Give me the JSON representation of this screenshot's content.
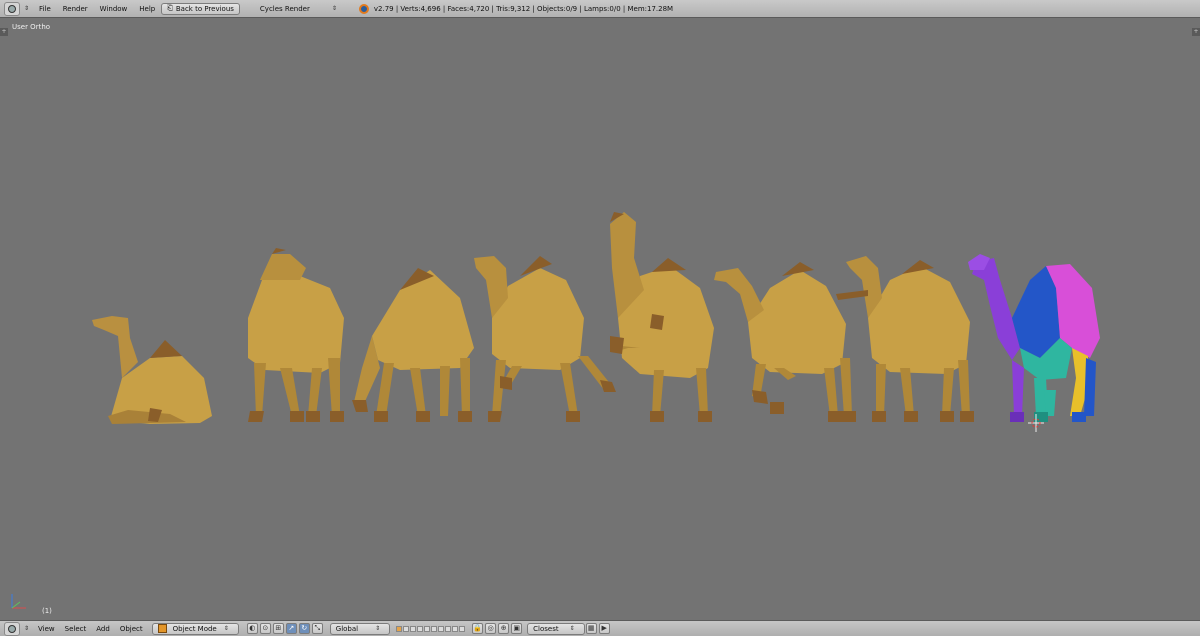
{
  "topbar": {
    "menus": [
      "File",
      "Render",
      "Window",
      "Help"
    ],
    "back_button": "Back to Previous",
    "render_engine": "Cycles Render",
    "stats": "v2.79 | Verts:4,696 | Faces:4,720 | Tris:9,312 | Objects:0/9 | Lamps:0/0 | Mem:17.28M"
  },
  "viewport": {
    "view_name": "User Ortho",
    "frame_label": "(1)"
  },
  "bottombar": {
    "menus": [
      "View",
      "Select",
      "Add",
      "Object"
    ],
    "mode": "Object Mode",
    "orientation": "Global",
    "snap_target": "Closest"
  },
  "colors": {
    "camel_body": "#c8a046",
    "camel_dark": "#8a5e2a",
    "uv_purple": "#8a3fd8",
    "uv_blue": "#2356c8",
    "uv_teal": "#2fb6a0",
    "uv_magenta": "#d84fd8",
    "uv_yellow": "#e8c02a"
  }
}
